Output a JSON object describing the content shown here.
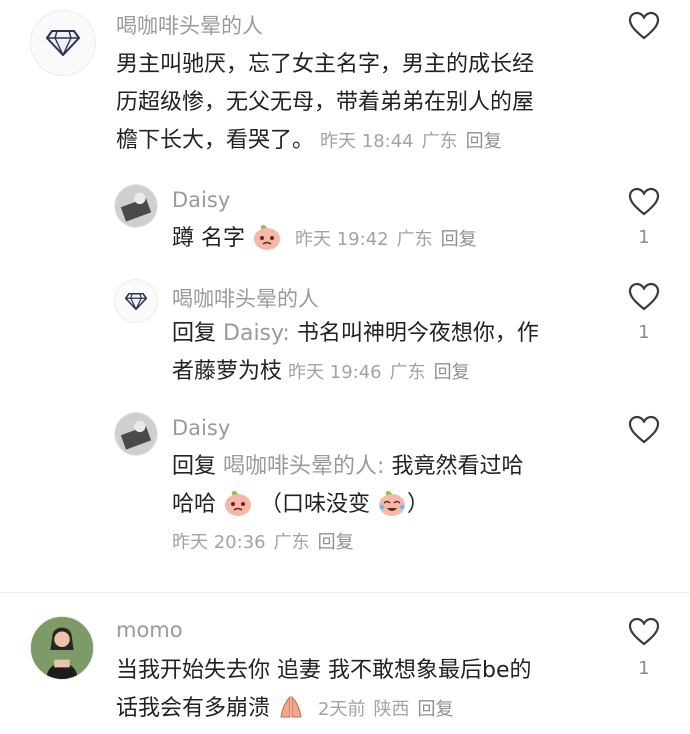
{
  "comments": [
    {
      "username": "喝咖啡头晕的人",
      "text": "男主叫驰厌，忘了女主名字，男主的成长经历超级惨，无父无母，带着弟弟在别人的屋檐下长大，看哭了。",
      "text_lines": [
        "男主叫驰厌，忘了女主名字，男主的成长经",
        "历超级惨，无父无母，带着弟弟在别人的屋",
        "檐下长大，看哭了。"
      ],
      "time": "昨天 18:44",
      "location": "广东",
      "reply_label": "回复",
      "likes": ""
    },
    {
      "username": "Daisy",
      "text": "蹲 名字",
      "time": "昨天 19:42",
      "location": "广东",
      "reply_label": "回复",
      "likes": "1"
    },
    {
      "username": "喝咖啡头晕的人",
      "reply_prefix": "回复",
      "reply_to": "Daisy:",
      "text_lines": [
        "书名叫神明今夜想你，作",
        "者藤萝为枝"
      ],
      "time": "昨天 19:46",
      "location": "广东",
      "reply_label": "回复",
      "likes": "1"
    },
    {
      "username": "Daisy",
      "reply_prefix": "回复",
      "reply_to": "喝咖啡头晕的人:",
      "text_lines": [
        "我竟然看过哈",
        "哈哈",
        "（口味没变"
      ],
      "text_close": "）",
      "time": "昨天 20:36",
      "location": "广东",
      "reply_label": "回复",
      "likes": ""
    },
    {
      "username": "momo",
      "text_lines": [
        "当我开始失去你 追妻 我不敢想象最后be的",
        "话我会有多崩溃"
      ],
      "time": "2天前",
      "location": "陕西",
      "reply_label": "回复",
      "likes": "1"
    }
  ]
}
